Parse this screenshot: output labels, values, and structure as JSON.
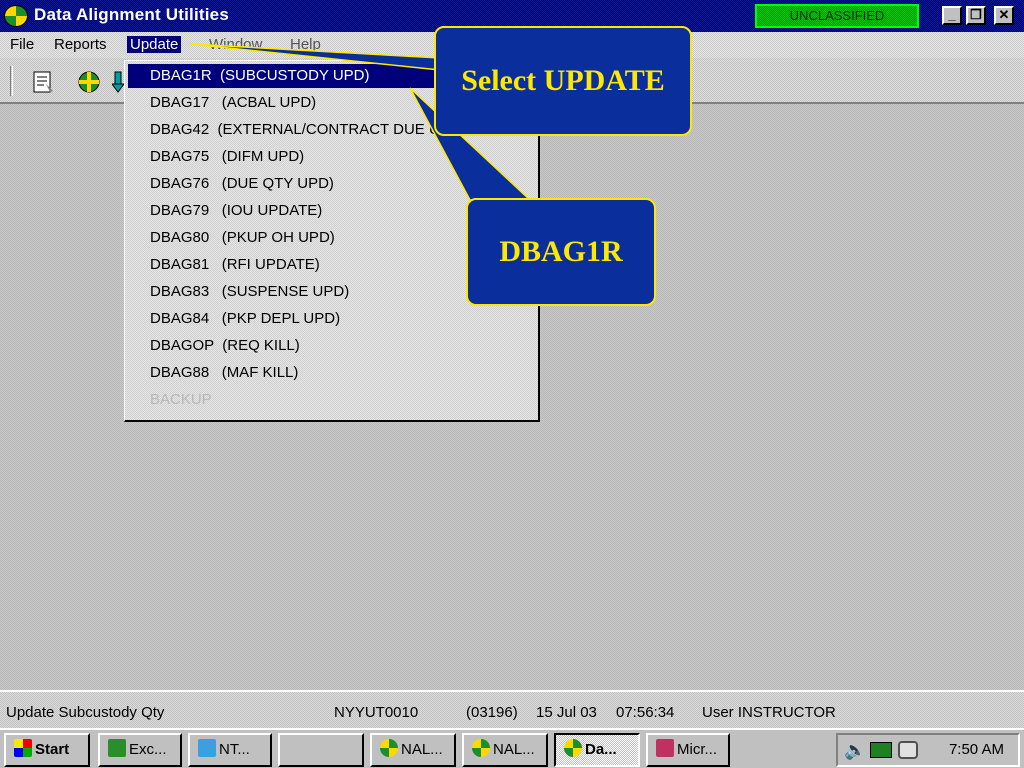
{
  "window": {
    "title": "Data Alignment Utilities",
    "classification": "UNCLASSIFIED",
    "controls": {
      "minimize": "_",
      "restore": "❐",
      "close": "✕"
    }
  },
  "menubar": {
    "items": [
      "File",
      "Reports",
      "Update",
      "Window",
      "Help"
    ]
  },
  "dropdown": {
    "items": [
      "DBAG1R  (SUBCUSTODY UPD)",
      "DBAG17   (ACBAL UPD)",
      "DBAG42  (EXTERNAL/CONTRACT DUE UPD)",
      "DBAG75   (DIFM UPD)",
      "DBAG76   (DUE QTY UPD)",
      "DBAG79   (IOU UPDATE)",
      "DBAG80   (PKUP OH UPD)",
      "DBAG81   (RFI UPDATE)",
      "DBAG83   (SUSPENSE UPD)",
      "DBAG84   (PKP DEPL UPD)",
      "DBAGOP  (REQ KILL)",
      "DBAG88   (MAF KILL)",
      "BACKUP"
    ],
    "selected_index": 0,
    "disabled_index": 12
  },
  "callouts": {
    "select_update": "Select UPDATE",
    "dbag1r": "DBAG1R"
  },
  "statusbar": {
    "message": "Update Subcustody Qty",
    "host": "NYYUT0010",
    "session": "(03196)",
    "date": "15 Jul 03",
    "time": "07:56:34",
    "user": "User INSTRUCTOR"
  },
  "taskbar": {
    "start": "Start",
    "buttons": [
      "Exc...",
      "NT...",
      "",
      "NAL...",
      "NAL...",
      "Da...",
      "Micr..."
    ],
    "clock": "7:50 AM"
  },
  "colors": {
    "titlebar": "#00007b",
    "callout_bg": "#0a2e9c",
    "callout_text": "#ffe800",
    "classification": "#00a000"
  }
}
